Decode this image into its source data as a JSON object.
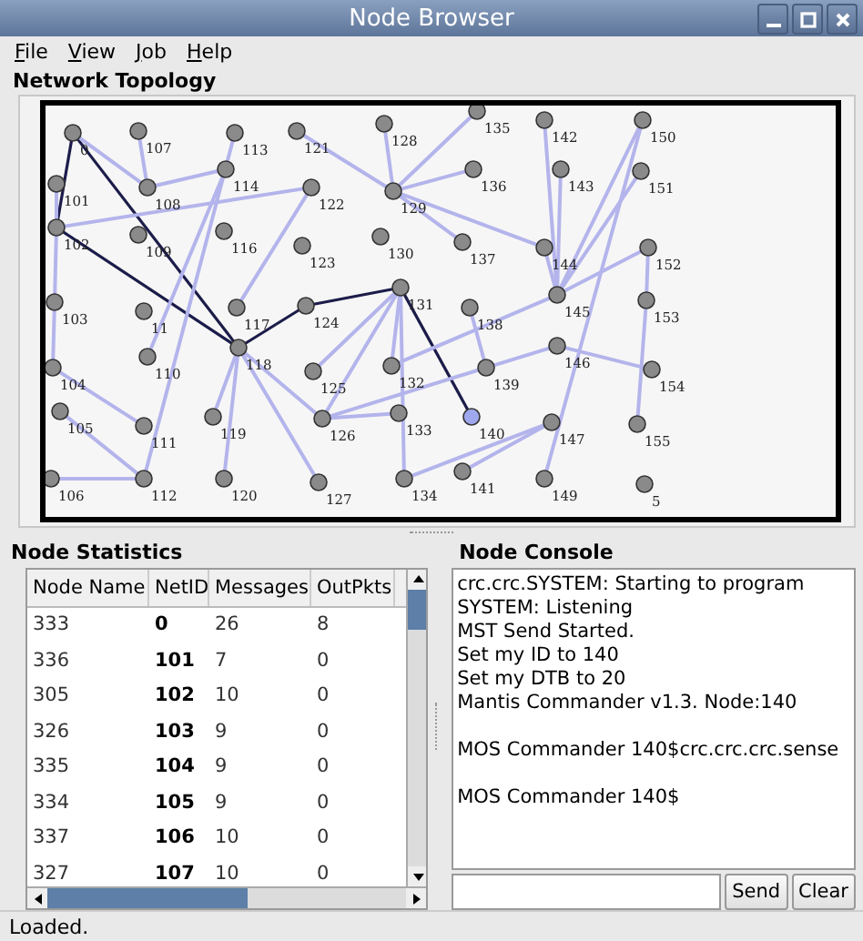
{
  "window": {
    "title": "Node Browser"
  },
  "menu": [
    {
      "label": "File"
    },
    {
      "label": "View"
    },
    {
      "label": "Job"
    },
    {
      "label": "Help"
    }
  ],
  "topology": {
    "title": "Network Topology",
    "nodes": [
      {
        "label": "0",
        "selected": false
      },
      {
        "label": "107",
        "selected": false
      },
      {
        "label": "113",
        "selected": false
      },
      {
        "label": "121",
        "selected": false
      },
      {
        "label": "128",
        "selected": false
      },
      {
        "label": "101",
        "selected": false
      },
      {
        "label": "108",
        "selected": false
      },
      {
        "label": "114",
        "selected": false
      },
      {
        "label": "122",
        "selected": false
      },
      {
        "label": "129",
        "selected": false
      },
      {
        "label": "102",
        "selected": false
      },
      {
        "label": "109",
        "selected": false
      },
      {
        "label": "116",
        "selected": false
      },
      {
        "label": "123",
        "selected": false
      },
      {
        "label": "130",
        "selected": false
      },
      {
        "label": "103",
        "selected": false
      },
      {
        "label": "11",
        "selected": false
      },
      {
        "label": "117",
        "selected": false
      },
      {
        "label": "124",
        "selected": false
      },
      {
        "label": "131",
        "selected": false
      },
      {
        "label": "118",
        "selected": false
      },
      {
        "label": "110",
        "selected": false
      },
      {
        "label": "104",
        "selected": false
      },
      {
        "label": "125",
        "selected": false
      },
      {
        "label": "132",
        "selected": false
      },
      {
        "label": "105",
        "selected": false
      },
      {
        "label": "111",
        "selected": false
      },
      {
        "label": "119",
        "selected": false
      },
      {
        "label": "126",
        "selected": false
      },
      {
        "label": "133",
        "selected": false
      },
      {
        "label": "106",
        "selected": false
      },
      {
        "label": "112",
        "selected": false
      },
      {
        "label": "120",
        "selected": false
      },
      {
        "label": "127",
        "selected": false
      },
      {
        "label": "134",
        "selected": false
      },
      {
        "label": "135",
        "selected": false
      },
      {
        "label": "142",
        "selected": false
      },
      {
        "label": "150",
        "selected": false
      },
      {
        "label": "136",
        "selected": false
      },
      {
        "label": "143",
        "selected": false
      },
      {
        "label": "151",
        "selected": false
      },
      {
        "label": "137",
        "selected": false
      },
      {
        "label": "144",
        "selected": false
      },
      {
        "label": "152",
        "selected": false
      },
      {
        "label": "145",
        "selected": false
      },
      {
        "label": "153",
        "selected": false
      },
      {
        "label": "138",
        "selected": false
      },
      {
        "label": "146",
        "selected": false
      },
      {
        "label": "139",
        "selected": false
      },
      {
        "label": "154",
        "selected": false
      },
      {
        "label": "140",
        "selected": true
      },
      {
        "label": "147",
        "selected": false
      },
      {
        "label": "155",
        "selected": false
      },
      {
        "label": "141",
        "selected": false
      },
      {
        "label": "149",
        "selected": false
      },
      {
        "label": "5",
        "selected": false
      }
    ],
    "links": [
      {
        "kind": "route"
      },
      {
        "kind": "route"
      },
      {
        "kind": "route"
      },
      {
        "kind": "route"
      },
      {
        "kind": "route"
      },
      {
        "kind": "route"
      },
      {
        "kind": "link"
      },
      {
        "kind": "link"
      },
      {
        "kind": "link"
      },
      {
        "kind": "link"
      },
      {
        "kind": "link"
      },
      {
        "kind": "link"
      },
      {
        "kind": "link"
      },
      {
        "kind": "link"
      },
      {
        "kind": "link"
      },
      {
        "kind": "link"
      },
      {
        "kind": "link"
      },
      {
        "kind": "link"
      },
      {
        "kind": "link"
      },
      {
        "kind": "link"
      },
      {
        "kind": "link"
      },
      {
        "kind": "link"
      },
      {
        "kind": "link"
      },
      {
        "kind": "link"
      },
      {
        "kind": "link"
      },
      {
        "kind": "link"
      },
      {
        "kind": "link"
      },
      {
        "kind": "link"
      },
      {
        "kind": "link"
      },
      {
        "kind": "link"
      },
      {
        "kind": "link"
      },
      {
        "kind": "link"
      },
      {
        "kind": "link"
      },
      {
        "kind": "link"
      },
      {
        "kind": "link"
      },
      {
        "kind": "link"
      },
      {
        "kind": "link"
      },
      {
        "kind": "link"
      },
      {
        "kind": "link"
      },
      {
        "kind": "link"
      },
      {
        "kind": "link"
      },
      {
        "kind": "link"
      },
      {
        "kind": "link"
      },
      {
        "kind": "link"
      },
      {
        "kind": "link"
      },
      {
        "kind": "link"
      },
      {
        "kind": "link"
      },
      {
        "kind": "link"
      },
      {
        "kind": "link"
      },
      {
        "kind": "link"
      }
    ]
  },
  "statistics": {
    "title": "Node Statistics",
    "columns": [
      "Node Name",
      "NetID",
      "Messages",
      "OutPkts"
    ],
    "rows": [
      [
        "333",
        "0",
        "26",
        "8"
      ],
      [
        "336",
        "101",
        "7",
        "0"
      ],
      [
        "305",
        "102",
        "10",
        "0"
      ],
      [
        "326",
        "103",
        "9",
        "0"
      ],
      [
        "335",
        "104",
        "9",
        "0"
      ],
      [
        "334",
        "105",
        "9",
        "0"
      ],
      [
        "337",
        "106",
        "10",
        "0"
      ],
      [
        "327",
        "107",
        "10",
        "0"
      ]
    ]
  },
  "console": {
    "title": "Node Console",
    "lines": [
      {
        "text": "crc.crc.SYSTEM: Starting to program",
        "gap_before": false
      },
      {
        "text": "SYSTEM: Listening",
        "gap_before": false
      },
      {
        "text": "MST Send Started.",
        "gap_before": false
      },
      {
        "text": "Set my ID to 140",
        "gap_before": false
      },
      {
        "text": "Set my DTB to 20",
        "gap_before": false
      },
      {
        "text": "Mantis Commander v1.3. Node:140",
        "gap_before": false
      },
      {
        "text": "MOS Commander 140$crc.crc.crc.sense",
        "gap_before": true
      },
      {
        "text": "MOS Commander 140$",
        "gap_before": true
      }
    ],
    "buttons": [
      "Send",
      "Clear"
    ]
  },
  "status_bar": "Loaded."
}
